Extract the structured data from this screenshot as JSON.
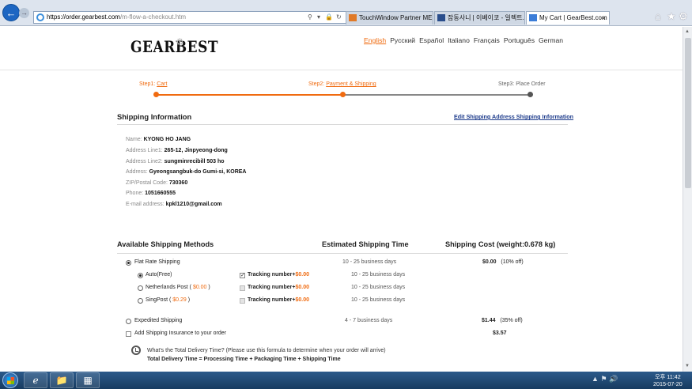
{
  "browser": {
    "url_host": "https://order.gearbest.com",
    "url_path": "/m-flow-a-checkout.htm",
    "tabs": [
      {
        "label": "TouchWindow Partner MES"
      },
      {
        "label": "잡동사니 | 이베이코 - 일렉트..."
      },
      {
        "label": "My Cart | GearBest.com"
      }
    ]
  },
  "header": {
    "logo": "GEARBEST",
    "languages": [
      "English",
      "Русский",
      "Español",
      "Italiano",
      "Français",
      "Português",
      "German"
    ]
  },
  "steps": [
    {
      "prefix": "Step1:",
      "label": "Cart"
    },
    {
      "prefix": "Step2:",
      "label": "Payment & Shipping"
    },
    {
      "prefix": "Step3:",
      "label": "Place Order"
    }
  ],
  "shipping_info": {
    "title": "Shipping Information",
    "edit_link": "Edit Shipping Address Shipping Information",
    "fields": [
      {
        "label": "Name",
        "value": "KYONG HO JANG"
      },
      {
        "label": "Address Line1",
        "value": "265-12, Jinpyeong-dong"
      },
      {
        "label": "Address Line2",
        "value": "sungminrecibill 503 ho"
      },
      {
        "label": "Address",
        "value": "Gyeongsangbuk-do Gumi-si, KOREA"
      },
      {
        "label": "ZIP/Postal Code",
        "value": "730360"
      },
      {
        "label": "Phone",
        "value": "1051660555"
      },
      {
        "label": "E-mail address",
        "value": "kpkl1210@gmail.com"
      }
    ]
  },
  "methods": {
    "headers": [
      "Available Shipping Methods",
      "Estimated Shipping Time",
      "Shipping Cost (weight:0.678 kg)"
    ],
    "flat_rate": {
      "label": "Flat Rate Shipping",
      "time": "10 - 25 business days",
      "cost": "$0.00",
      "discount": "(10% off)"
    },
    "sub_options": [
      {
        "label": "Auto(Free)",
        "price": "",
        "tracking_label": "Tracking number+",
        "tracking_price": "$0.00",
        "time": "10 - 25 business days"
      },
      {
        "label": "Netherlands Post (",
        "price": "$0.00",
        "suffix": ")",
        "tracking_label": "Tracking number+",
        "tracking_price": "$0.00",
        "time": "10 - 25 business days"
      },
      {
        "label": "SingPost (",
        "price": "$0.29",
        "suffix": ")",
        "tracking_label": "Tracking number+",
        "tracking_price": "$0.00",
        "time": "10 - 25 business days"
      }
    ],
    "expedited": {
      "label": "Expedited Shipping",
      "time": "4 - 7 business days",
      "cost": "$1.44",
      "discount": "(35% off)"
    },
    "insurance": {
      "label": "Add Shipping Insurance to your order",
      "cost": "$3.57"
    },
    "formula_question": "What's the Total Delivery Time? (Please use this formula to determine when your order will arrive)",
    "formula": "Total Delivery Time = Processing Time + Packaging Time + Shipping Time"
  },
  "taskbar": {
    "time": "오후 11:42",
    "date": "2015-07-20"
  },
  "colors": {
    "accent": "#f06b10",
    "link": "#1e3c8c",
    "taskbar": "#1f466f"
  }
}
